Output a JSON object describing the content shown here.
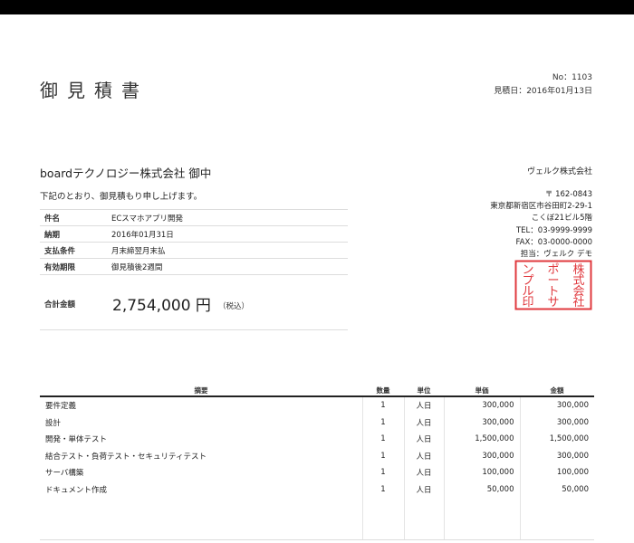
{
  "title": "御見積書",
  "doc_no": "No：1103",
  "issue_date": "見積日：2016年01月13日",
  "client": "boardテクノロジー株式会社 御中",
  "intro": "下記のとおり、御見積もり申し上げます。",
  "info": [
    {
      "key": "件名",
      "value": "ECスマホアプリ開発"
    },
    {
      "key": "納期",
      "value": "2016年01月31日"
    },
    {
      "key": "支払条件",
      "value": "月末締翌月末払"
    },
    {
      "key": "有効期限",
      "value": "御見積後2週間"
    }
  ],
  "total": {
    "label": "合計金額",
    "amount": "2,754,000 円",
    "tax_note": "（税込）"
  },
  "issuer": {
    "company": "ヴェルク株式会社",
    "address": [
      "〒 162-0843",
      "東京都新宿区市谷田町2-29-1",
      "こくぼ21ビル5階",
      "TEL：03-9999-9999",
      "FAX：03-0000-0000",
      "担当：ヴェルク デモ"
    ]
  },
  "seal": {
    "columns": [
      [
        "株",
        "式",
        "会",
        "社"
      ],
      [
        "ポ",
        "ー",
        "ト",
        "サ"
      ],
      [
        "ン",
        "プ",
        "ル",
        "印"
      ]
    ],
    "color": "#e0393e"
  },
  "items": {
    "headers": [
      "摘要",
      "数量",
      "単位",
      "単価",
      "金額"
    ],
    "rows": [
      [
        "要件定義",
        "1",
        "人日",
        "300,000",
        "300,000"
      ],
      [
        "設計",
        "1",
        "人日",
        "300,000",
        "300,000"
      ],
      [
        "開発・単体テスト",
        "1",
        "人日",
        "1,500,000",
        "1,500,000"
      ],
      [
        "結合テスト・負荷テスト・セキュリティテスト",
        "1",
        "人日",
        "300,000",
        "300,000"
      ],
      [
        "サーバ構築",
        "1",
        "人日",
        "100,000",
        "100,000"
      ],
      [
        "ドキュメント作成",
        "1",
        "人日",
        "50,000",
        "50,000"
      ]
    ]
  }
}
